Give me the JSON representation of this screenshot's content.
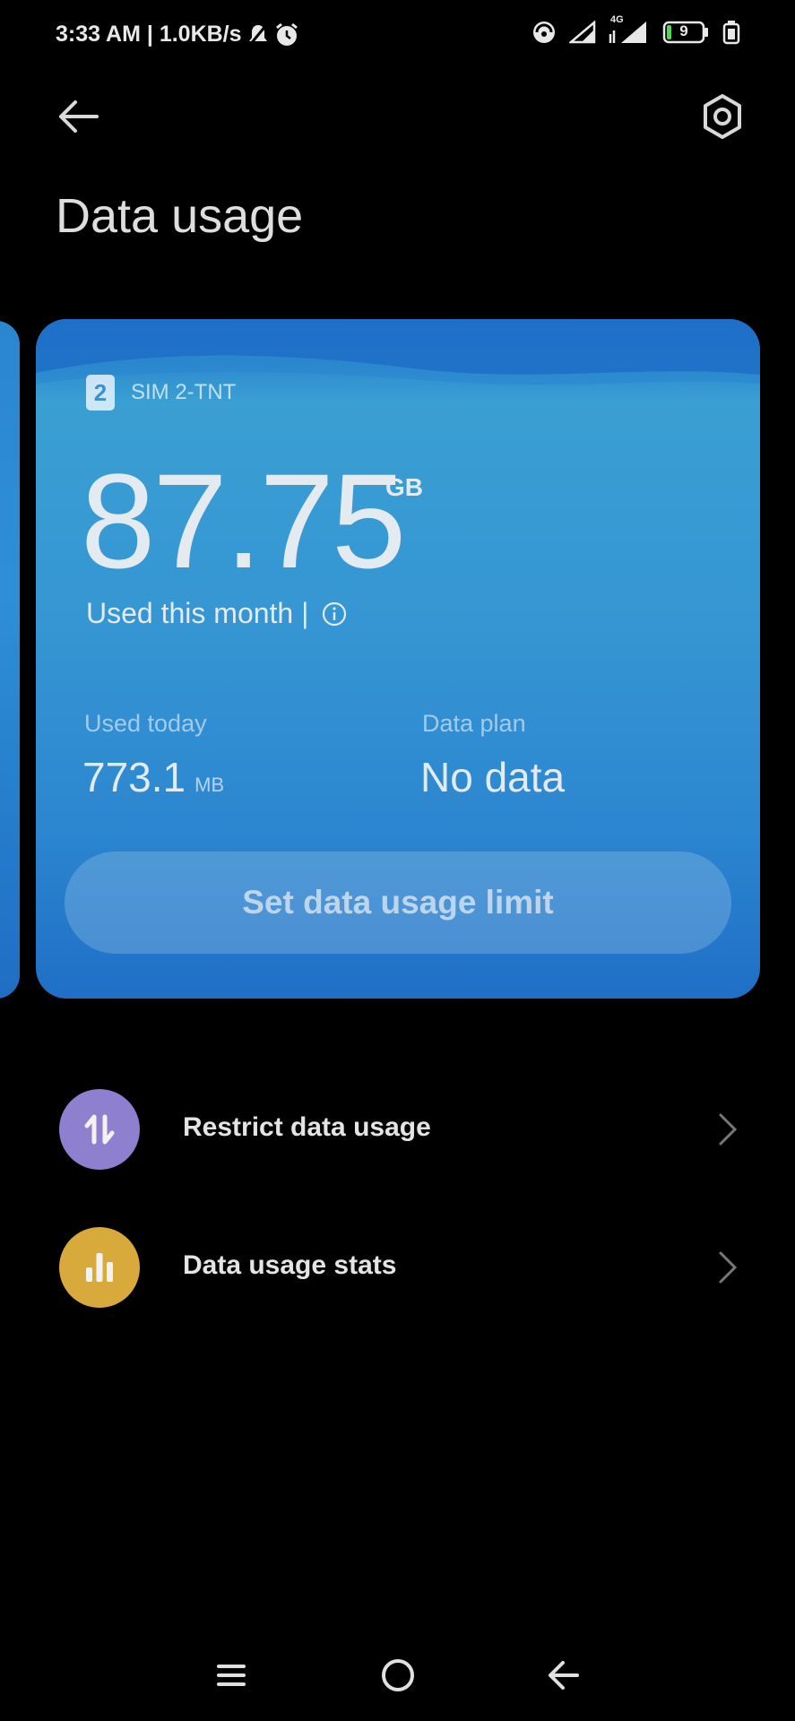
{
  "status_bar": {
    "time_speed": "3:33 AM | 1.0KB/s",
    "network_type": "4G",
    "battery": "9"
  },
  "header": {
    "title": "Data usage"
  },
  "card": {
    "sim_number": "2",
    "sim_label": "SIM 2-TNT",
    "used_month_value": "87.75",
    "used_month_unit": "GB",
    "used_month_label": "Used this month |",
    "used_today_label": "Used today",
    "used_today_value": "773.1",
    "used_today_unit": "MB",
    "data_plan_label": "Data plan",
    "data_plan_value": "No data",
    "limit_button_label": "Set data usage limit"
  },
  "menu": [
    {
      "label": "Restrict data usage",
      "icon": "restrict-data-icon",
      "color": "#8f7fcf"
    },
    {
      "label": "Data usage stats",
      "icon": "bar-chart-icon",
      "color": "#d8aa3c"
    }
  ],
  "colors": {
    "card_accent": "#3596d3",
    "background": "#000000"
  }
}
